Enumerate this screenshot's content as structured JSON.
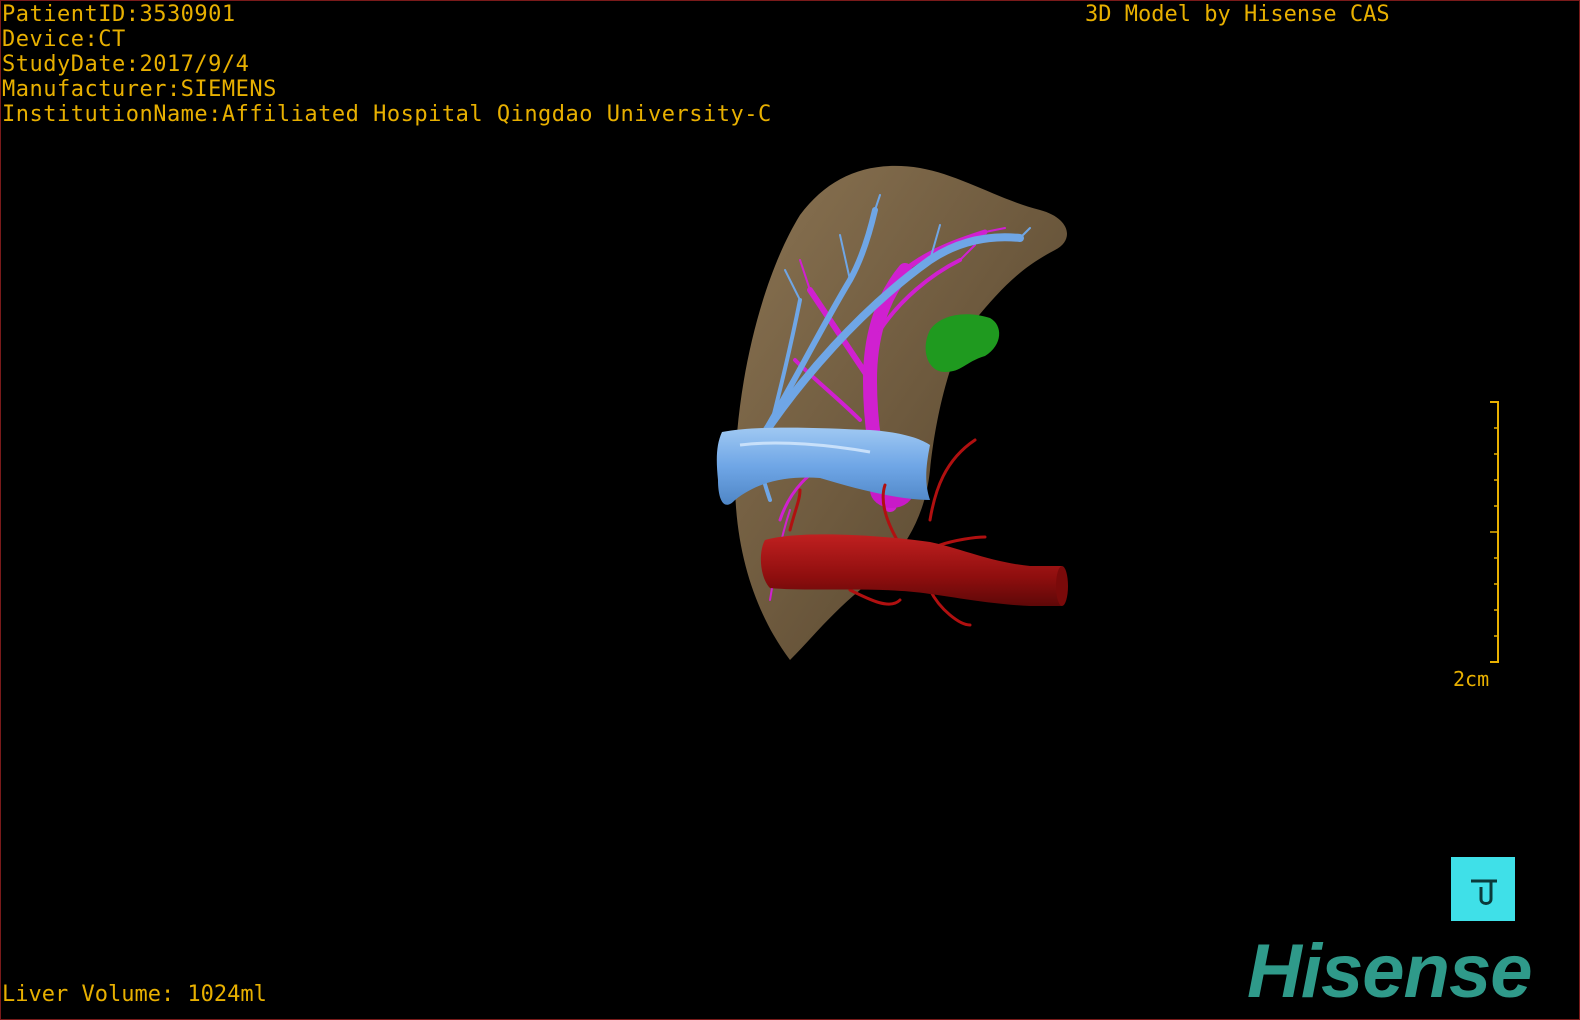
{
  "overlay": {
    "patient_id": "PatientID:3530901",
    "device": "Device:CT",
    "study_date": "StudyDate:2017/9/4",
    "manufacturer": "Manufacturer:SIEMENS",
    "institution": "InstitutionName:Affiliated Hospital Qingdao University-C",
    "credit": "3D Model by Hisense CAS",
    "liver_volume": "Liver Volume: 1024ml"
  },
  "scale_bar": {
    "label": "2cm"
  },
  "orientation_cube": {
    "icon": "orientation-cube-icon"
  },
  "logo": {
    "text": "Hisense"
  },
  "colors": {
    "overlay_text": "#e8b000",
    "liver": "#7a6548",
    "hepatic_vein": "#6fa6e6",
    "portal_vein": "#d020d0",
    "artery": "#a01010",
    "gallbladder": "#1f9a1f",
    "orientation_cube": "#3fe0e8",
    "logo": "#2f9a8a"
  }
}
